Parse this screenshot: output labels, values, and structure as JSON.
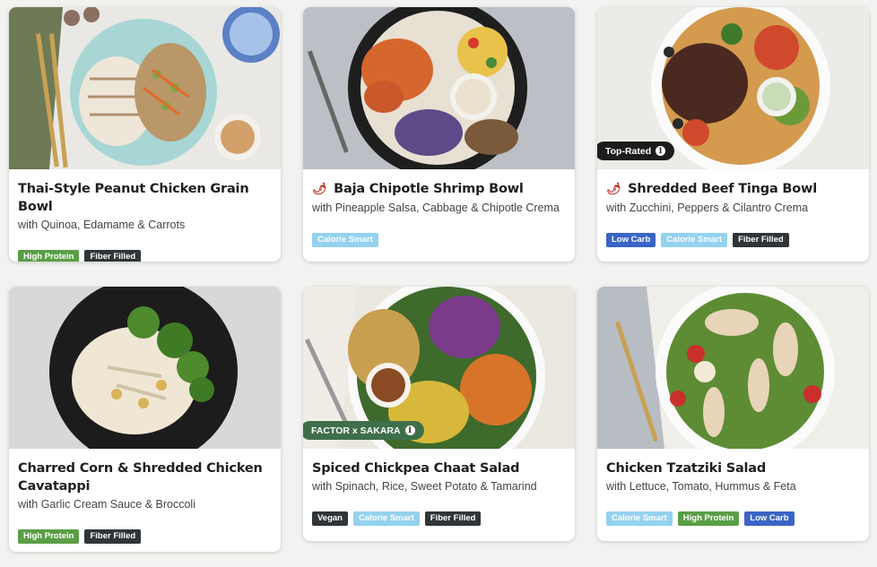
{
  "meals": [
    {
      "title": "Thai-Style Peanut Chicken Grain Bowl",
      "subtitle": "with Quinoa, Edamame & Carrots",
      "spicy": false,
      "badge": "",
      "tags": [
        "High Protein",
        "Fiber Filled"
      ]
    },
    {
      "title": "Baja Chipotle Shrimp Bowl",
      "subtitle": "with Pineapple Salsa, Cabbage & Chipotle Crema",
      "spicy": true,
      "badge": "",
      "tags": [
        "Calorie Smart"
      ]
    },
    {
      "title": "Shredded Beef Tinga Bowl",
      "subtitle": "with Zucchini, Peppers & Cilantro Crema",
      "spicy": true,
      "badge": "Top-Rated",
      "tags": [
        "Low Carb",
        "Calorie Smart",
        "Fiber Filled"
      ]
    },
    {
      "title": "Charred Corn & Shredded Chicken Cavatappi",
      "subtitle": "with Garlic Cream Sauce & Broccoli",
      "spicy": false,
      "badge": "",
      "tags": [
        "High Protein",
        "Fiber Filled"
      ]
    },
    {
      "title": "Spiced Chickpea Chaat Salad",
      "subtitle": "with Spinach, Rice, Sweet Potato & Tamarind",
      "spicy": false,
      "badge": "FACTOR x SAKARA",
      "tags": [
        "Vegan",
        "Calorie Smart",
        "Fiber Filled"
      ]
    },
    {
      "title": "Chicken Tzatziki Salad",
      "subtitle": "with Lettuce, Tomato, Hummus & Feta",
      "spicy": false,
      "badge": "",
      "tags": [
        "Calorie Smart",
        "High Protein",
        "Low Carb"
      ]
    }
  ],
  "icons": {
    "spicy": "chili-pepper-icon",
    "info": "info-icon"
  },
  "colors": {
    "high_protein": "#5a9e46",
    "fiber_filled": "#303539",
    "calorie_smart": "#94d2ee",
    "low_carb": "#3a64c6",
    "top_rated_badge": "#1c1c1c",
    "sakara_badge": "#3f6f4a"
  }
}
